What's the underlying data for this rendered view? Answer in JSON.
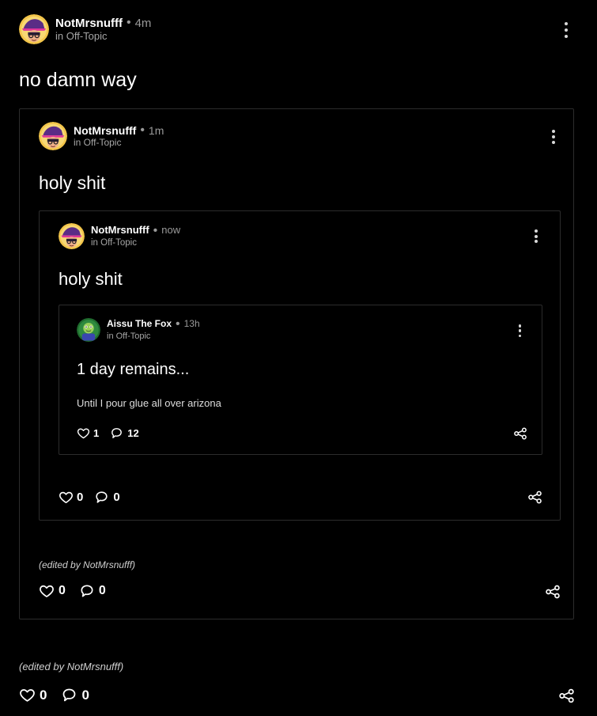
{
  "post": {
    "author": "NotMrsnufff",
    "time": "4m",
    "community": "in Off-Topic",
    "title": "no damn way",
    "edited_note": "(edited by NotMrsnufff)",
    "likes": "0",
    "comments": "0",
    "quoted": {
      "author": "NotMrsnufff",
      "time": "1m",
      "community": "in Off-Topic",
      "title": "holy shit",
      "edited_note": "(edited by NotMrsnufff)",
      "likes": "0",
      "comments": "0",
      "quoted": {
        "author": "NotMrsnufff",
        "time": "now",
        "community": "in Off-Topic",
        "title": "holy shit",
        "likes": "0",
        "comments": "0",
        "quoted": {
          "author": "Aissu The Fox",
          "time": "13h",
          "community": "in Off-Topic",
          "title": "1 day remains...",
          "body": "Until I pour glue all over arizona",
          "likes": "1",
          "comments": "12"
        }
      }
    }
  },
  "icons": {
    "more": "more-vertical-icon",
    "like": "heart-icon",
    "comment": "comment-icon",
    "share": "share-icon"
  },
  "colors": {
    "background": "#000000",
    "border": "#2c2c2c",
    "secondary_text": "#9a9a9a"
  }
}
